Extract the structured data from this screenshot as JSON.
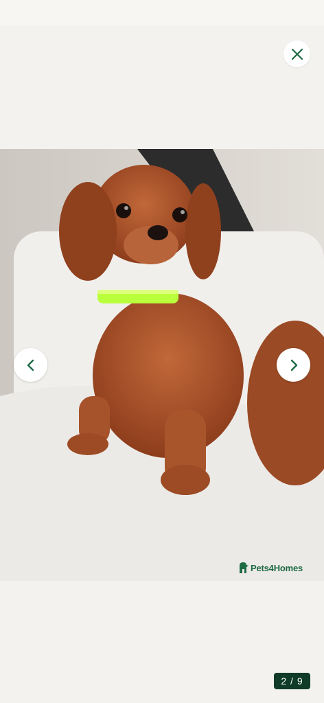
{
  "gallery": {
    "close_icon": "close-icon",
    "prev_icon": "chevron-left-icon",
    "next_icon": "chevron-right-icon",
    "photo_subject": "ruby-puppy-photo",
    "watermark": "Pets4Homes",
    "counter": "2 / 9",
    "colors": {
      "accent": "#1e6a43",
      "counter_bg": "#0f3b28",
      "background": "#f3f2ef"
    }
  }
}
